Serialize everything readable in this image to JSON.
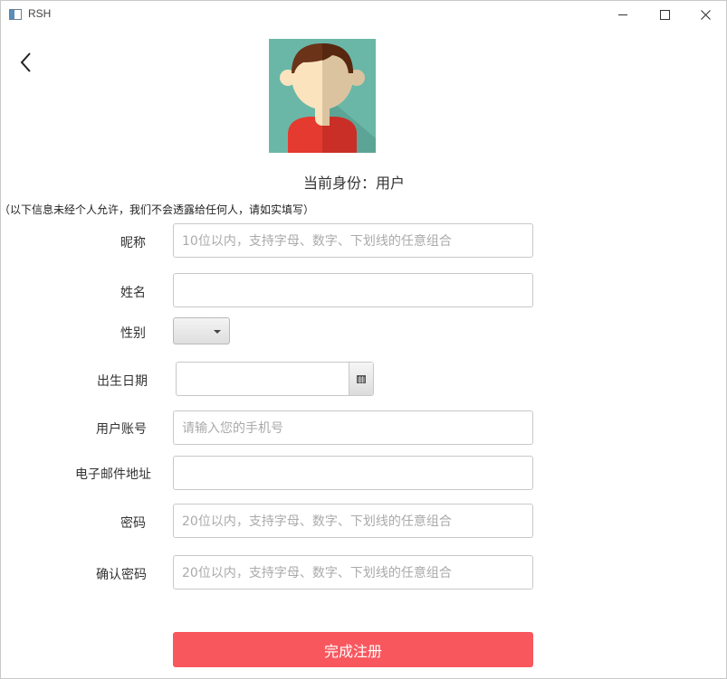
{
  "window": {
    "title": "RSH"
  },
  "header": {
    "identity_text": "当前身份：用户"
  },
  "notice": "（以下信息未经个人允许，我们不会透露给任何人，请如实填写）",
  "form": {
    "nickname": {
      "label": "昵称",
      "placeholder": "10位以内，支持字母、数字、下划线的任意组合"
    },
    "name": {
      "label": "姓名",
      "placeholder": ""
    },
    "gender": {
      "label": "性别",
      "value": ""
    },
    "birthdate": {
      "label": "出生日期",
      "value": ""
    },
    "account": {
      "label": "用户账号",
      "placeholder": "请输入您的手机号"
    },
    "email": {
      "label": "电子邮件地址",
      "placeholder": ""
    },
    "password": {
      "label": "密码",
      "placeholder": "20位以内，支持字母、数字、下划线的任意组合"
    },
    "confirm_password": {
      "label": "确认密码",
      "placeholder": "20位以内，支持字母、数字、下划线的任意组合"
    }
  },
  "submit_label": "完成注册",
  "icons": {
    "back": "chevron-left-icon",
    "calendar": "calendar-icon",
    "dropdown": "caret-down-icon",
    "minimize": "minimize-icon",
    "maximize": "maximize-icon",
    "close": "close-icon"
  },
  "colors": {
    "accent": "#f8575e",
    "avatar_bg": "#6ab7a7",
    "avatar_shirt": "#e53a2f"
  }
}
